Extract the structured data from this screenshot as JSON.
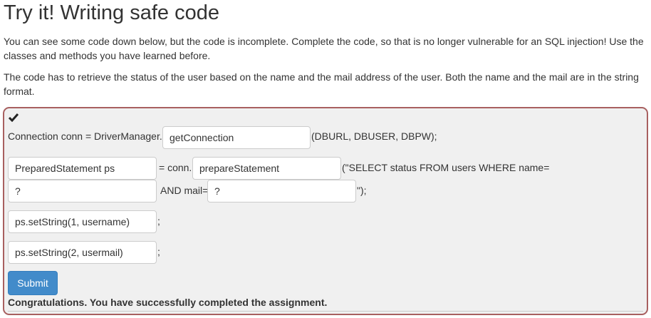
{
  "title": "Try it! Writing safe code",
  "para1": "You can see some code down below, but the code is incomplete. Complete the code, so that is no longer vulnerable for an SQL injection! Use the classes and methods you have learned before.",
  "para2": "The code has to retrieve the status of the user based on the name and the mail address of the user. Both the name and the mail are in the string format.",
  "form": {
    "check_icon": "check-icon",
    "l1a": "Connection conn = DriverManager.",
    "i1": "getConnection",
    "l1b": "(DBURL, DBUSER, DBPW);",
    "i2": "PreparedStatement ps",
    "l2a": "= conn.",
    "i3": "prepareStatement",
    "l2b": "(\"SELECT status FROM users WHERE name=",
    "i4": "?",
    "l3a": "AND mail=",
    "i5": "?",
    "l3b": "\");",
    "i6": "ps.setString(1, username)",
    "semi1": ";",
    "i7": "ps.setString(2, usermail)",
    "semi2": ";",
    "submit": "Submit",
    "feedback": "Congratulations. You have successfully completed the assignment."
  }
}
